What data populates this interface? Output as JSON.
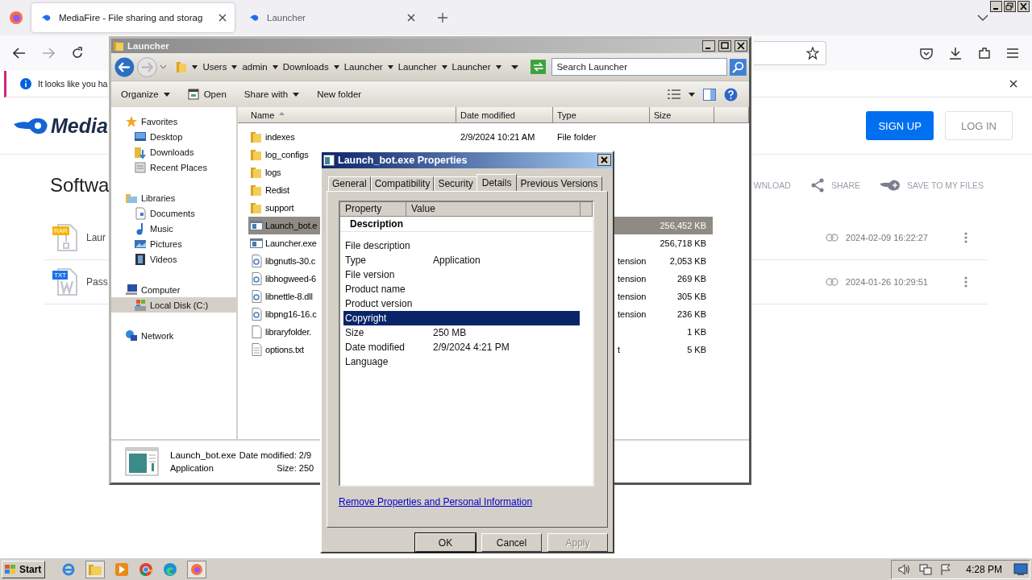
{
  "browser": {
    "tabs": [
      {
        "title": "MediaFire - File sharing and storag",
        "selected": true
      },
      {
        "title": "Launcher",
        "selected": false
      }
    ],
    "notification": "It looks like you ha"
  },
  "page": {
    "logo": "Media",
    "heading": "Softwa",
    "signup": "SIGN UP",
    "login": "LOG IN",
    "actions": [
      {
        "label": "WNLOAD",
        "kind": "download"
      },
      {
        "label": "SHARE",
        "kind": "share"
      },
      {
        "label": "SAVE TO MY FILES",
        "kind": "save"
      }
    ],
    "files": [
      {
        "badge": "RAR",
        "kind": "rar",
        "name": "Laur",
        "date": "2024-02-09 16:22:27"
      },
      {
        "badge": "TXT",
        "kind": "txt",
        "name": "Pass",
        "date": "2024-01-26 10:29:51"
      }
    ]
  },
  "explorer": {
    "title": "Launcher",
    "breadcrumb": [
      "Users",
      "admin",
      "Downloads",
      "Launcher",
      "Launcher",
      "Launcher"
    ],
    "search": {
      "placeholder": "Search Launcher"
    },
    "toolbar": [
      {
        "label": "Organize",
        "kind": "menu"
      },
      {
        "label": "Open",
        "kind": "open"
      },
      {
        "label": "Share with",
        "kind": "menu"
      },
      {
        "label": "New folder",
        "kind": "plain"
      }
    ],
    "nav": [
      {
        "label": "Favorites",
        "kind": "star",
        "selected": false,
        "children": [
          {
            "label": "Desktop",
            "kind": "desktop",
            "selected": false
          },
          {
            "label": "Downloads",
            "kind": "downloads",
            "selected": false
          },
          {
            "label": "Recent Places",
            "kind": "recent",
            "selected": false
          }
        ]
      },
      {
        "label": "Libraries",
        "kind": "library",
        "selected": false,
        "children": [
          {
            "label": "Documents",
            "kind": "document",
            "selected": false
          },
          {
            "label": "Music",
            "kind": "music",
            "selected": false
          },
          {
            "label": "Pictures",
            "kind": "pictures",
            "selected": false
          },
          {
            "label": "Videos",
            "kind": "videos",
            "selected": false
          }
        ]
      },
      {
        "label": "Computer",
        "kind": "computer",
        "selected": false,
        "children": [
          {
            "label": "Local Disk (C:)",
            "kind": "disk",
            "selected": true
          }
        ]
      },
      {
        "label": "Network",
        "kind": "network",
        "selected": false
      }
    ],
    "columns": [
      "Name",
      "Date modified",
      "Type",
      "Size"
    ],
    "rows": [
      {
        "name": "indexes",
        "kind": "folder",
        "date": "2/9/2024 10:21 AM",
        "type": "File folder",
        "selected": false
      },
      {
        "name": "log_configs",
        "kind": "folder",
        "selected": false
      },
      {
        "name": "logs",
        "kind": "folder",
        "selected": false
      },
      {
        "name": "Redist",
        "kind": "folder",
        "selected": false
      },
      {
        "name": "support",
        "kind": "folder",
        "selected": false
      },
      {
        "name": "Launch_bot.e",
        "kind": "exe",
        "size": "256,452 KB",
        "selected": true
      },
      {
        "name": "Launcher.exe",
        "kind": "exe",
        "size": "256,718 KB",
        "selected": false
      },
      {
        "name": "libgnutls-30.c",
        "kind": "dll",
        "type": "tension",
        "size": "2,053 KB",
        "selected": false
      },
      {
        "name": "libhogweed-6",
        "kind": "dll",
        "type": "tension",
        "size": "269 KB",
        "selected": false
      },
      {
        "name": "libnettle-8.dll",
        "kind": "dll",
        "type": "tension",
        "size": "305 KB",
        "selected": false
      },
      {
        "name": "libpng16-16.c",
        "kind": "dll",
        "type": "tension",
        "size": "236 KB",
        "selected": false
      },
      {
        "name": "libraryfolder.",
        "kind": "file",
        "size": "1 KB",
        "selected": false
      },
      {
        "name": "options.txt",
        "kind": "txt",
        "type": "t",
        "size": "5 KB",
        "selected": false
      }
    ],
    "status": {
      "name": "Launch_bot.exe",
      "type": "Application",
      "fields": [
        {
          "label": "Date modified:",
          "value": "2/9"
        },
        {
          "label": "Size:",
          "value": "250"
        }
      ]
    }
  },
  "properties": {
    "title": "Launch_bot.exe Properties",
    "tabs": [
      {
        "label": "General",
        "selected": false
      },
      {
        "label": "Compatibility",
        "selected": false
      },
      {
        "label": "Security",
        "selected": false
      },
      {
        "label": "Details",
        "selected": true
      },
      {
        "label": "Previous Versions",
        "selected": false
      }
    ],
    "columns": [
      "Property",
      "Value"
    ],
    "section": "Description",
    "props": [
      {
        "name": "File description",
        "selected": false
      },
      {
        "name": "Type",
        "value": "Application",
        "selected": false
      },
      {
        "name": "File version",
        "selected": false
      },
      {
        "name": "Product name",
        "selected": false
      },
      {
        "name": "Product version",
        "selected": false
      },
      {
        "name": "Copyright",
        "selected": true
      },
      {
        "name": "Size",
        "value": "250 MB",
        "selected": false
      },
      {
        "name": "Date modified",
        "value": "2/9/2024 4:21 PM",
        "selected": false
      },
      {
        "name": "Language",
        "selected": false
      }
    ],
    "link": "Remove Properties and Personal Information",
    "buttons": [
      {
        "label": "OK",
        "default": true,
        "disabled": false
      },
      {
        "label": "Cancel",
        "default": false,
        "disabled": false
      },
      {
        "label": "Apply",
        "default": false,
        "disabled": true
      }
    ]
  },
  "taskbar": {
    "start": "Start",
    "clock": "4:28 PM"
  }
}
